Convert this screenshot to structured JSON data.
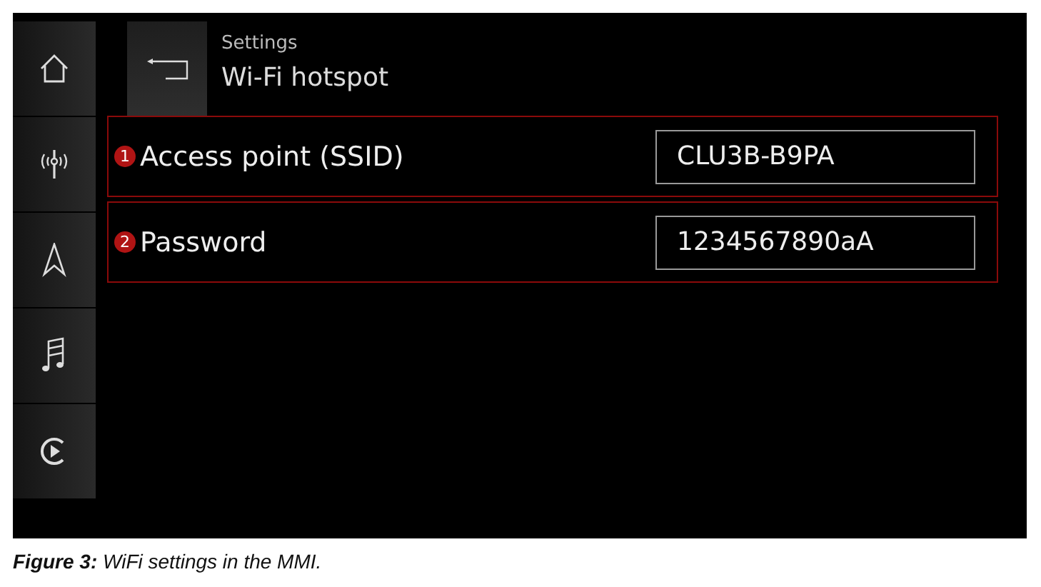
{
  "header": {
    "breadcrumb": "Settings",
    "title": "Wi-Fi hotspot"
  },
  "rows": [
    {
      "marker": "1",
      "label": "Access point (SSID)",
      "value": "CLU3B-B9PA"
    },
    {
      "marker": "2",
      "label": "Password",
      "value": "1234567890aA"
    }
  ],
  "caption": "**Figure 3:** WiFi settings in the MMI."
}
